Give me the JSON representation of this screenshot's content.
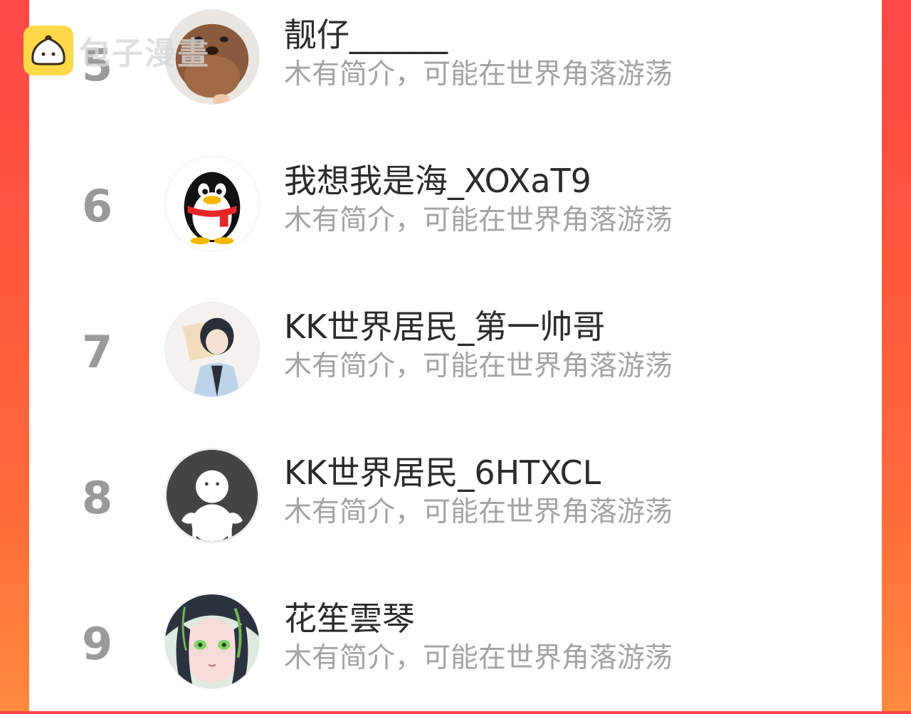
{
  "watermark": {
    "text": "包子漫畫",
    "icon": "bun-logo-icon"
  },
  "rows": [
    {
      "rank": "5",
      "name": "靓仔______",
      "bio": "木有简介，可能在世界角落游荡",
      "avatar": "dog-photo-avatar"
    },
    {
      "rank": "6",
      "name": "我想我是海_XOXaT9",
      "bio": "木有简介，可能在世界角落游荡",
      "avatar": "qq-penguin-avatar"
    },
    {
      "rank": "7",
      "name": "KK世界居民_第一帅哥",
      "bio": "木有简介，可能在世界角落游荡",
      "avatar": "anime-boy-avatar"
    },
    {
      "rank": "8",
      "name": "KK世界居民_6HTXCL",
      "bio": "木有简介，可能在世界角落游荡",
      "avatar": "default-user-avatar"
    },
    {
      "rank": "9",
      "name": "花笙雲琴",
      "bio": "木有简介，可能在世界角落游荡",
      "avatar": "anime-girl-avatar"
    }
  ],
  "colors": {
    "accent": "#ff4d45",
    "rank": "#9a9a9a",
    "name": "#2b2b2b",
    "bio": "#a3a3a3"
  }
}
